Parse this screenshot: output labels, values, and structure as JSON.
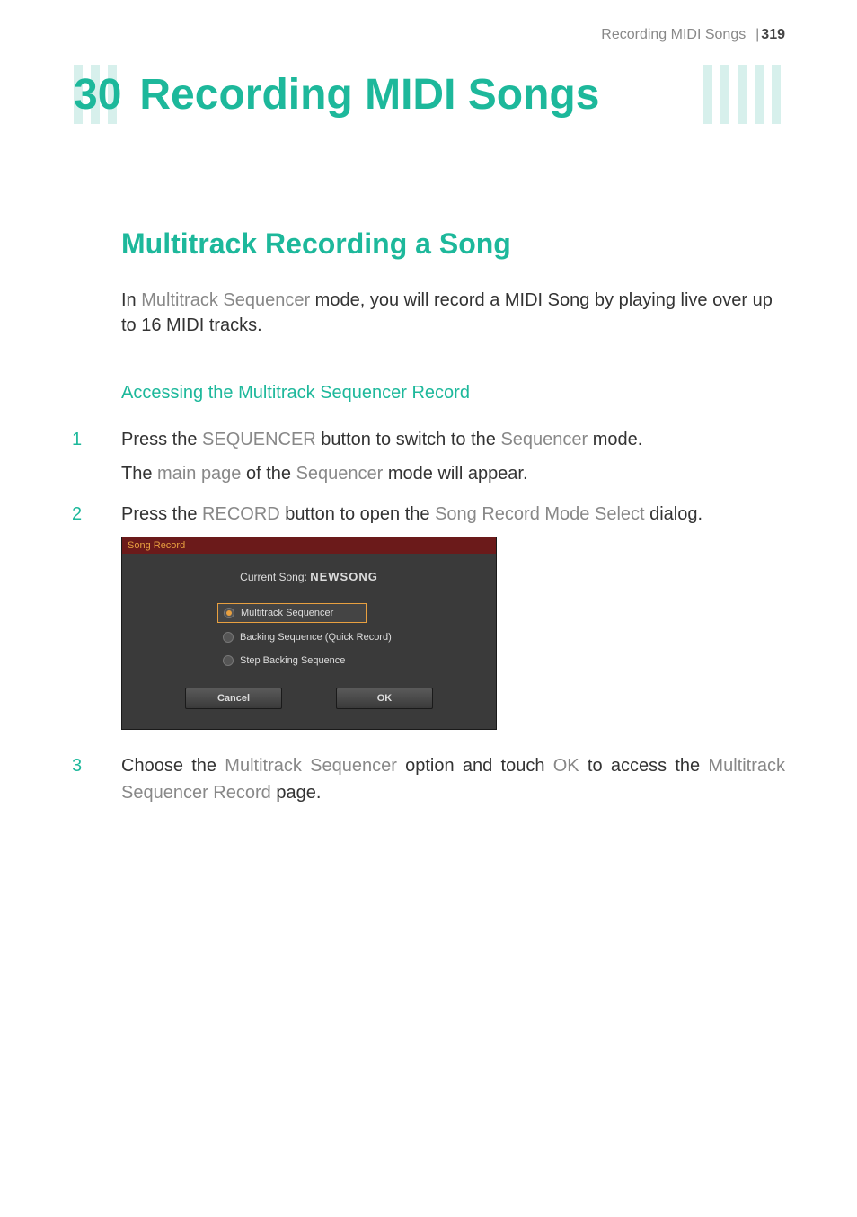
{
  "header": {
    "breadcrumb": "Recording MIDI Songs",
    "page_number": "319"
  },
  "chapter": {
    "number": "30",
    "title": "Recording MIDI Songs"
  },
  "section": {
    "title": "Multitrack Recording a Song",
    "intro_pre": "In ",
    "intro_emphasis": "Multitrack Sequencer",
    "intro_post": " mode, you will record a MIDI Song by playing live over up to 16 MIDI tracks."
  },
  "subsection": {
    "title": "Accessing the Multitrack Sequencer Record"
  },
  "steps": {
    "s1": {
      "num": "1",
      "pre": "Press the ",
      "emph1": "SEQUENCER",
      "mid": " button to switch to the ",
      "emph2": "Sequencer",
      "post": " mode.",
      "sub_pre": "The ",
      "sub_emph1": "main page",
      "sub_mid": " of the ",
      "sub_emph2": "Sequencer",
      "sub_post": " mode will appear."
    },
    "s2": {
      "num": "2",
      "pre": "Press the ",
      "emph1": "RECORD",
      "mid": " button to open the ",
      "emph2": "Song Record Mode Select",
      "post": " dialog."
    },
    "s3": {
      "num": "3",
      "pre": "Choose the ",
      "emph1": "Multitrack Sequencer",
      "mid": " option and touch ",
      "emph2": "OK",
      "mid2": " to access the ",
      "emph3": "Multitrack Sequencer Record",
      "post": " page."
    }
  },
  "dialog": {
    "title": "Song Record",
    "current_song_label": "Current Song: ",
    "current_song_value": "NEWSONG",
    "options": {
      "opt1": "Multitrack Sequencer",
      "opt2": "Backing Sequence (Quick Record)",
      "opt3": "Step Backing Sequence"
    },
    "cancel": "Cancel",
    "ok": "OK"
  }
}
